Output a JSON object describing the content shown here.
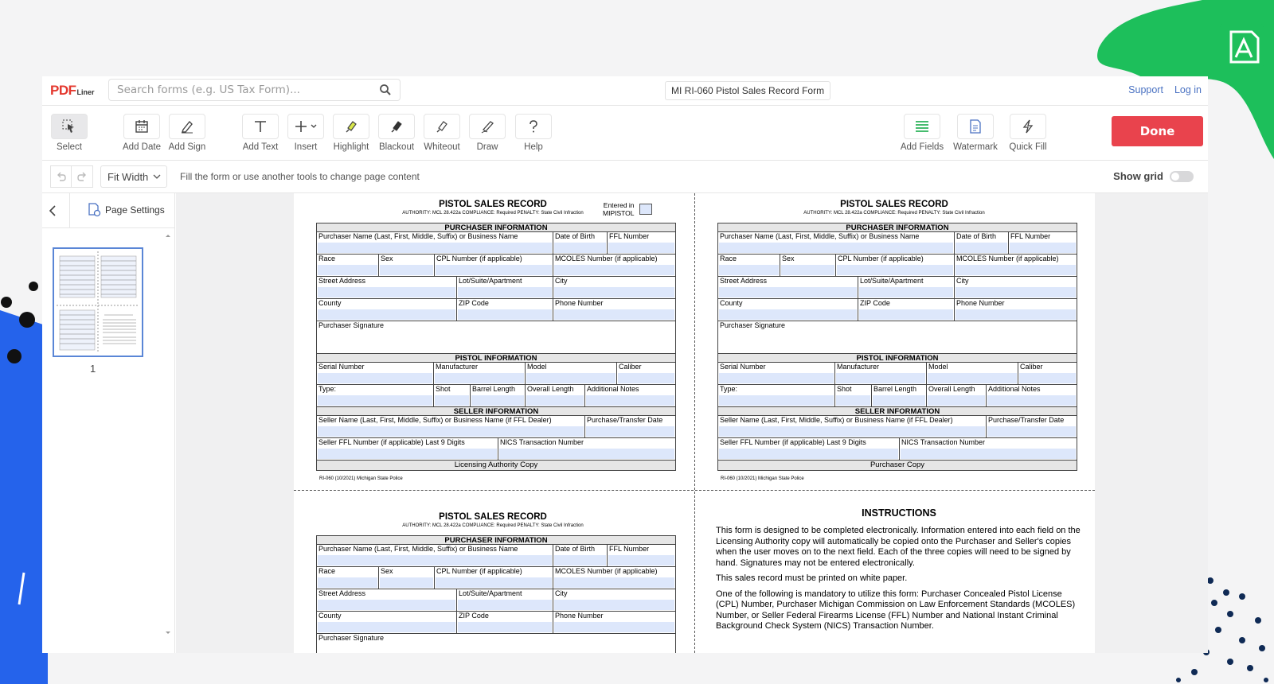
{
  "app": {
    "logo_pdf": "PDF",
    "logo_liner": "Liner",
    "search_placeholder": "Search forms (e.g. US Tax Form)...",
    "doc_title": "MI RI-060 Pistol Sales Record Form",
    "support": "Support",
    "login": "Log in"
  },
  "toolbar": {
    "select": "Select",
    "add_date": "Add Date",
    "add_sign": "Add Sign",
    "add_text": "Add Text",
    "insert": "Insert",
    "highlight": "Highlight",
    "blackout": "Blackout",
    "whiteout": "Whiteout",
    "draw": "Draw",
    "help": "Help",
    "add_fields": "Add Fields",
    "watermark": "Watermark",
    "quick_fill": "Quick Fill",
    "done": "Done"
  },
  "subbar": {
    "zoom": "Fit Width",
    "hint": "Fill the form or use another tools to change page content",
    "show_grid": "Show grid"
  },
  "sidebar": {
    "page_settings": "Page Settings",
    "page_number": "1"
  },
  "form": {
    "title": "PISTOL SALES RECORD",
    "authority": "AUTHORITY: MCL 28.422a  COMPLIANCE: Required  PENALTY: State Civil Infraction",
    "entered_in_1": "Entered in",
    "entered_in_2": "MIPISTOL",
    "purchaser_info": "PURCHASER INFORMATION",
    "purchaser_name": "Purchaser Name (Last, First, Middle, Suffix) or Business Name",
    "dob": "Date of Birth",
    "ffl": "FFL Number",
    "race": "Race",
    "sex": "Sex",
    "cpl": "CPL Number (if applicable)",
    "mcoles": "MCOLES Number (if applicable)",
    "street": "Street Address",
    "lot": "Lot/Suite/Apartment",
    "city": "City",
    "county": "County",
    "zip": "ZIP Code",
    "phone": "Phone Number",
    "signature": "Purchaser Signature",
    "pistol_info": "PISTOL INFORMATION",
    "serial": "Serial Number",
    "manufacturer": "Manufacturer",
    "model": "Model",
    "caliber": "Caliber",
    "type": "Type:",
    "shot": "Shot",
    "barrel": "Barrel Length",
    "overall": "Overall Length",
    "notes": "Additional Notes",
    "seller_info": "SELLER INFORMATION",
    "seller_name": "Seller Name (Last, First, Middle, Suffix) or Business Name (if FFL Dealer)",
    "transfer_date": "Purchase/Transfer Date",
    "seller_ffl": "Seller FFL Number (if applicable) Last 9 Digits",
    "nics": "NICS Transaction Number",
    "copy_licensing": "Licensing Authority Copy",
    "copy_purchaser": "Purchaser Copy",
    "footer": "RI-060 (10/2021)   Michigan State Police"
  },
  "instructions": {
    "title": "INSTRUCTIONS",
    "p1": "This form is designed to be completed electronically.  Information entered into each field on the Licensing Authority copy will automatically be copied onto the Purchaser and Seller's copies when the user moves on to the next field.  Each of the three copies will need to be signed by hand.  Signatures may not be entered electronically.",
    "p2": "This sales record must be printed on white paper.",
    "p3": "One of the following is mandatory to utilize this form:  Purchaser Concealed Pistol License (CPL) Number, Purchaser Michigan Commission on Law Enforcement Standards (MCOLES) Number, or Seller Federal Firearms License (FFL) Number and National Instant Criminal Background Check System (NICS) Transaction Number."
  },
  "colors": {
    "accent_green": "#1db954",
    "accent_blue": "#2563eb",
    "done_red": "#e9434d",
    "link_blue": "#4a72c2",
    "field_fill": "#dde7fb"
  }
}
